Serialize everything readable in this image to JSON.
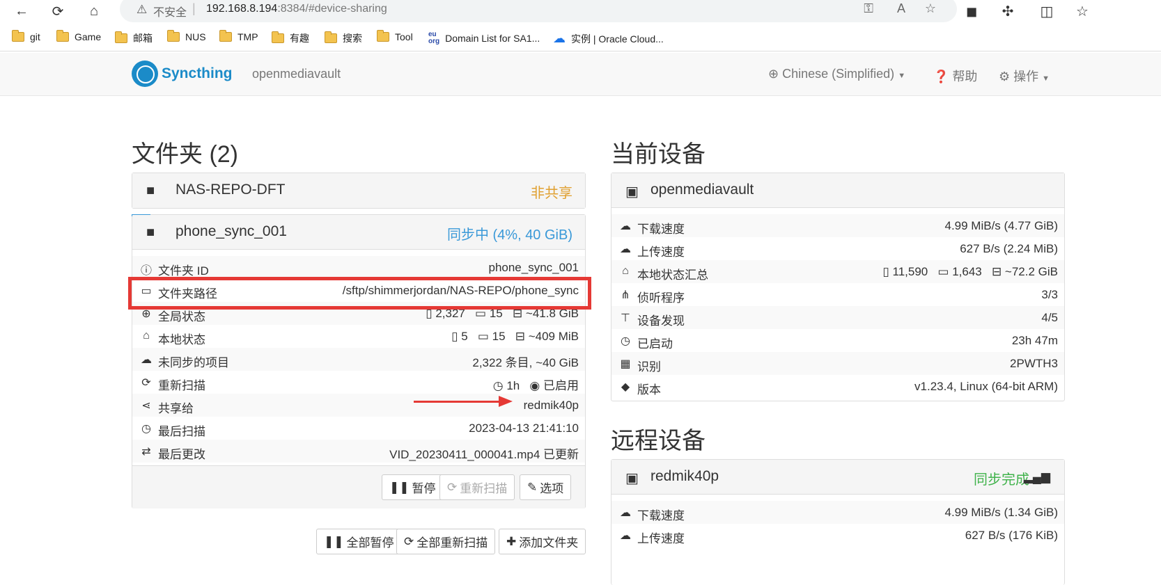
{
  "browser": {
    "insecure_label": "不安全",
    "url_host": "192.168.8.194",
    "url_rest": ":8384/#device-sharing",
    "bookmarks": [
      "git",
      "Game",
      "邮箱",
      "NUS",
      "TMP",
      "有趣",
      "搜索",
      "Tool",
      "Domain List for SA1...",
      "实例 | Oracle Cloud..."
    ],
    "bookmark_icons": [
      "folder-icon",
      "folder-icon",
      "folder-icon",
      "folder-icon",
      "folder-icon",
      "folder-icon",
      "folder-icon",
      "folder-icon",
      "eu-org-icon",
      "cloud-icon"
    ]
  },
  "nav": {
    "brand": "Syncthing",
    "hostname": "openmediavault",
    "language": "Chinese (Simplified)",
    "help": "帮助",
    "actions": "操作"
  },
  "folders": {
    "heading": "文件夹 (2)",
    "folder1": {
      "name": "NAS-REPO-DFT",
      "status": "非共享"
    },
    "folder2": {
      "name": "phone_sync_001",
      "status": "同步中 (4%, 40 GiB)",
      "rows": {
        "id": {
          "label": "文件夹 ID",
          "value": "phone_sync_001"
        },
        "path": {
          "label": "文件夹路径",
          "value": "/sftp/shimmerjordan/NAS-REPO/phone_sync"
        },
        "global": {
          "label": "全局状态",
          "files": "2,327",
          "dirs": "15",
          "size": "~41.8 GiB"
        },
        "local": {
          "label": "本地状态",
          "files": "5",
          "dirs": "15",
          "size": "~409 MiB"
        },
        "out_of_sync": {
          "label": "未同步的项目",
          "value": "2,322 条目, ~40 GiB"
        },
        "rescan": {
          "label": "重新扫描",
          "interval": "1h",
          "watcher": "已启用"
        },
        "shared": {
          "label": "共享给",
          "value": "redmik40p"
        },
        "last_scan": {
          "label": "最后扫描",
          "value": "2023-04-13 21:41:10"
        },
        "last_change": {
          "label": "最后更改",
          "value": "VID_20230411_000041.mp4 已更新"
        }
      },
      "buttons": {
        "pause": "暂停",
        "rescan": "重新扫描",
        "options": "选项"
      }
    },
    "bottom_buttons": {
      "pause_all": "全部暂停",
      "rescan_all": "全部重新扫描",
      "add_folder": "添加文件夹"
    }
  },
  "this_device": {
    "heading": "当前设备",
    "name": "openmediavault",
    "rows": {
      "download": {
        "label": "下载速度",
        "value": "4.99 MiB/s (4.77 GiB)"
      },
      "upload": {
        "label": "上传速度",
        "value": "627 B/s (2.24 MiB)"
      },
      "local_state": {
        "label": "本地状态汇总",
        "files": "11,590",
        "dirs": "1,643",
        "size": "~72.2 GiB"
      },
      "listeners": {
        "label": "侦听程序",
        "value": "3/3"
      },
      "discovery": {
        "label": "设备发现",
        "value": "4/5"
      },
      "uptime": {
        "label": "已启动",
        "value": "23h 47m"
      },
      "identity": {
        "label": "识别",
        "value": "2PWTH3"
      },
      "version": {
        "label": "版本",
        "value": "v1.23.4, Linux (64-bit ARM)"
      }
    }
  },
  "remote_devices": {
    "heading": "远程设备",
    "device1": {
      "name": "redmik40p",
      "status": "同步完成",
      "rows": {
        "download": {
          "label": "下载速度",
          "value": "4.99 MiB/s (1.34 GiB)"
        },
        "upload": {
          "label": "上传速度",
          "value": "627 B/s (176 KiB)"
        }
      }
    }
  },
  "colors": {
    "brand": "#1b8bc8",
    "link": "#3a99d8",
    "success": "#3fb24a",
    "warning": "#e0a030",
    "annotation": "#e53935"
  }
}
